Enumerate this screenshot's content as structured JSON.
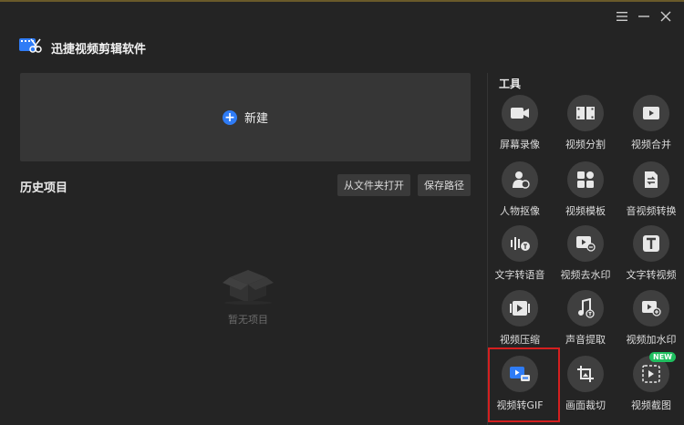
{
  "app": {
    "title": "迅捷视频剪辑软件"
  },
  "main": {
    "new_label": "新建"
  },
  "history": {
    "title": "历史项目",
    "open_folder": "从文件夹打开",
    "save_path": "保存路径",
    "empty_text": "暂无项目"
  },
  "tools": {
    "title": "工具",
    "new_badge": "NEW",
    "items": [
      {
        "label": "屏幕录像",
        "icon": "screen-record-icon"
      },
      {
        "label": "视频分割",
        "icon": "video-split-icon"
      },
      {
        "label": "视频合并",
        "icon": "video-merge-icon"
      },
      {
        "label": "人物抠像",
        "icon": "portrait-cutout-icon"
      },
      {
        "label": "视频模板",
        "icon": "video-template-icon"
      },
      {
        "label": "音视频转换",
        "icon": "av-convert-icon"
      },
      {
        "label": "文字转语音",
        "icon": "text-to-speech-icon"
      },
      {
        "label": "视频去水印",
        "icon": "remove-watermark-icon"
      },
      {
        "label": "文字转视频",
        "icon": "text-to-video-icon"
      },
      {
        "label": "视频压缩",
        "icon": "video-compress-icon"
      },
      {
        "label": "声音提取",
        "icon": "audio-extract-icon"
      },
      {
        "label": "视频加水印",
        "icon": "add-watermark-icon"
      },
      {
        "label": "视频转GIF",
        "icon": "video-to-gif-icon"
      },
      {
        "label": "画面裁切",
        "icon": "crop-icon"
      },
      {
        "label": "视频截图",
        "icon": "video-screenshot-icon"
      }
    ]
  },
  "colors": {
    "accent": "#2f7cf6",
    "highlight": "#d41f1f",
    "badge": "#1fbf5f"
  }
}
